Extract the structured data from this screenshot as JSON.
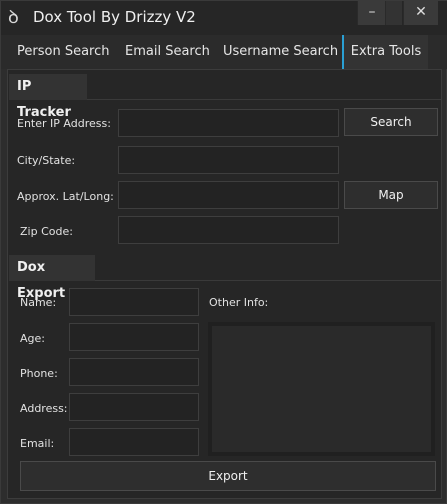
{
  "app": {
    "title": "Dox Tool By Drizzy V2",
    "icon": "script-logo-icon"
  },
  "window_controls": {
    "minimize": "–",
    "close": "✕"
  },
  "tabs": [
    {
      "label": "Person Search"
    },
    {
      "label": "Email Search"
    },
    {
      "label": "Username Search"
    },
    {
      "label": "Extra Tools",
      "active": true
    }
  ],
  "ip_tracker": {
    "title": "IP Tracker",
    "ip_label": "Enter IP Address:",
    "ip_value": "",
    "search_label": "Search",
    "city_label": "City/State:",
    "city_value": "",
    "latlong_label": "Approx. Lat/Long:",
    "latlong_value": "",
    "map_label": "Map",
    "zip_label": "Zip Code:",
    "zip_value": ""
  },
  "dox_export": {
    "title": "Dox Export",
    "name_label": "Name:",
    "age_label": "Age:",
    "phone_label": "Phone:",
    "address_label": "Address:",
    "email_label": "Email:",
    "other_label": "Other Info:",
    "export_label": "Export"
  },
  "colors": {
    "accent": "#2aa0d4",
    "background": "#2b2b2b"
  }
}
